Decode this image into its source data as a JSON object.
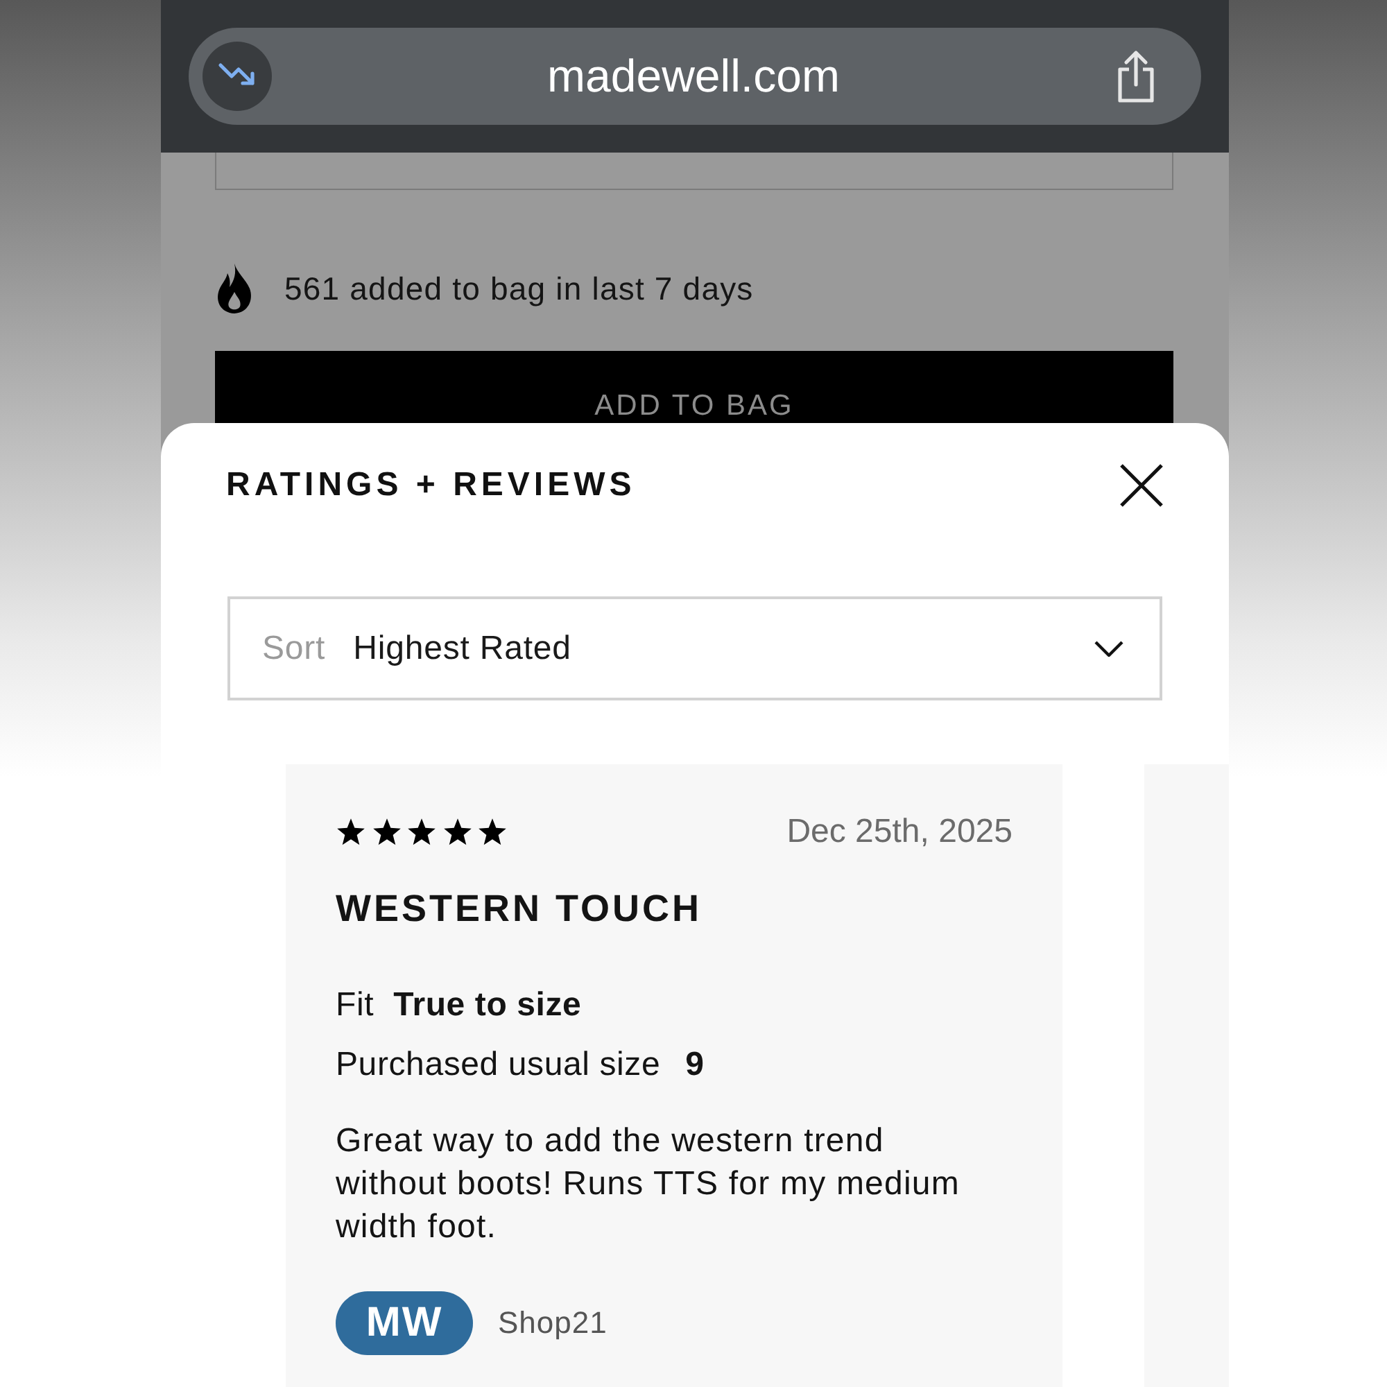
{
  "browser": {
    "url": "madewell.com"
  },
  "page": {
    "popularity": "561 added to bag in last 7 days",
    "add_to_bag": "ADD TO BAG"
  },
  "reviews_sheet": {
    "title": "RATINGS + REVIEWS",
    "sort": {
      "label": "Sort",
      "value": "Highest Rated"
    },
    "reviews": [
      {
        "stars": 5,
        "date": "Dec 25th, 2025",
        "title": "WESTERN TOUCH",
        "fit": {
          "label": "Fit",
          "value": "True to size"
        },
        "size": {
          "label": "Purchased usual size",
          "value": "9"
        },
        "body": "Great way to add the western trend without boots! Runs TTS for my medium width foot.",
        "reviewer": {
          "badge": "MW",
          "name": "Shop21"
        }
      }
    ]
  }
}
